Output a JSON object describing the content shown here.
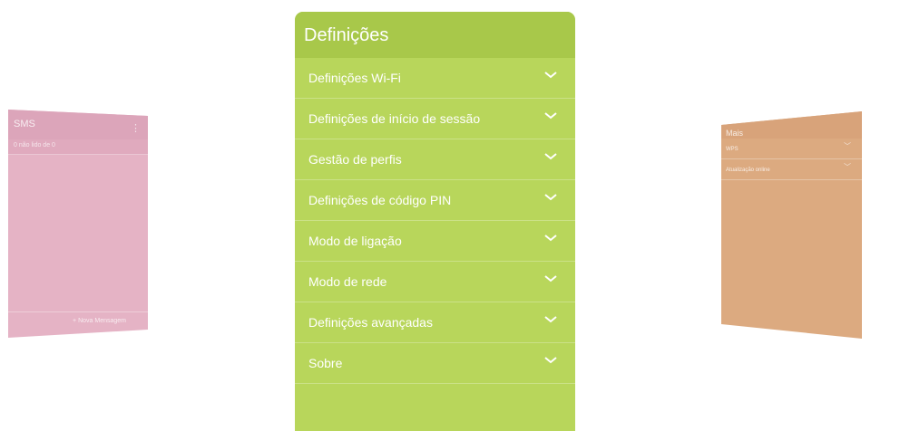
{
  "sms_card": {
    "title": "SMS",
    "more_glyph": "⋮",
    "unread_text": "0 não lido de 0",
    "new_message_label": "+ Nova Mensagem"
  },
  "main_card": {
    "title": "Definições",
    "items": [
      {
        "label": "Definições Wi-Fi",
        "icon": "chevron-down-icon"
      },
      {
        "label": "Definições de início de sessão",
        "icon": "chevron-down-icon"
      },
      {
        "label": "Gestão de perfis",
        "icon": "chevron-down-icon"
      },
      {
        "label": "Definições de código PIN",
        "icon": "chevron-down-icon"
      },
      {
        "label": "Modo de ligação",
        "icon": "chevron-down-icon"
      },
      {
        "label": "Modo de rede",
        "icon": "chevron-down-icon"
      },
      {
        "label": "Definições avançadas",
        "icon": "chevron-down-icon"
      },
      {
        "label": "Sobre",
        "icon": "chevron-down-icon"
      }
    ]
  },
  "mais_card": {
    "title": "Mais",
    "items": [
      {
        "label": "WPS",
        "icon": "chevron-down-icon"
      },
      {
        "label": "Atualização online",
        "icon": "chevron-down-icon"
      }
    ]
  },
  "colors": {
    "main_bg": "#b8d65b",
    "main_header": "#a8c84a",
    "sms_bg": "#e5b3c5",
    "mais_bg": "#dcaa80"
  }
}
